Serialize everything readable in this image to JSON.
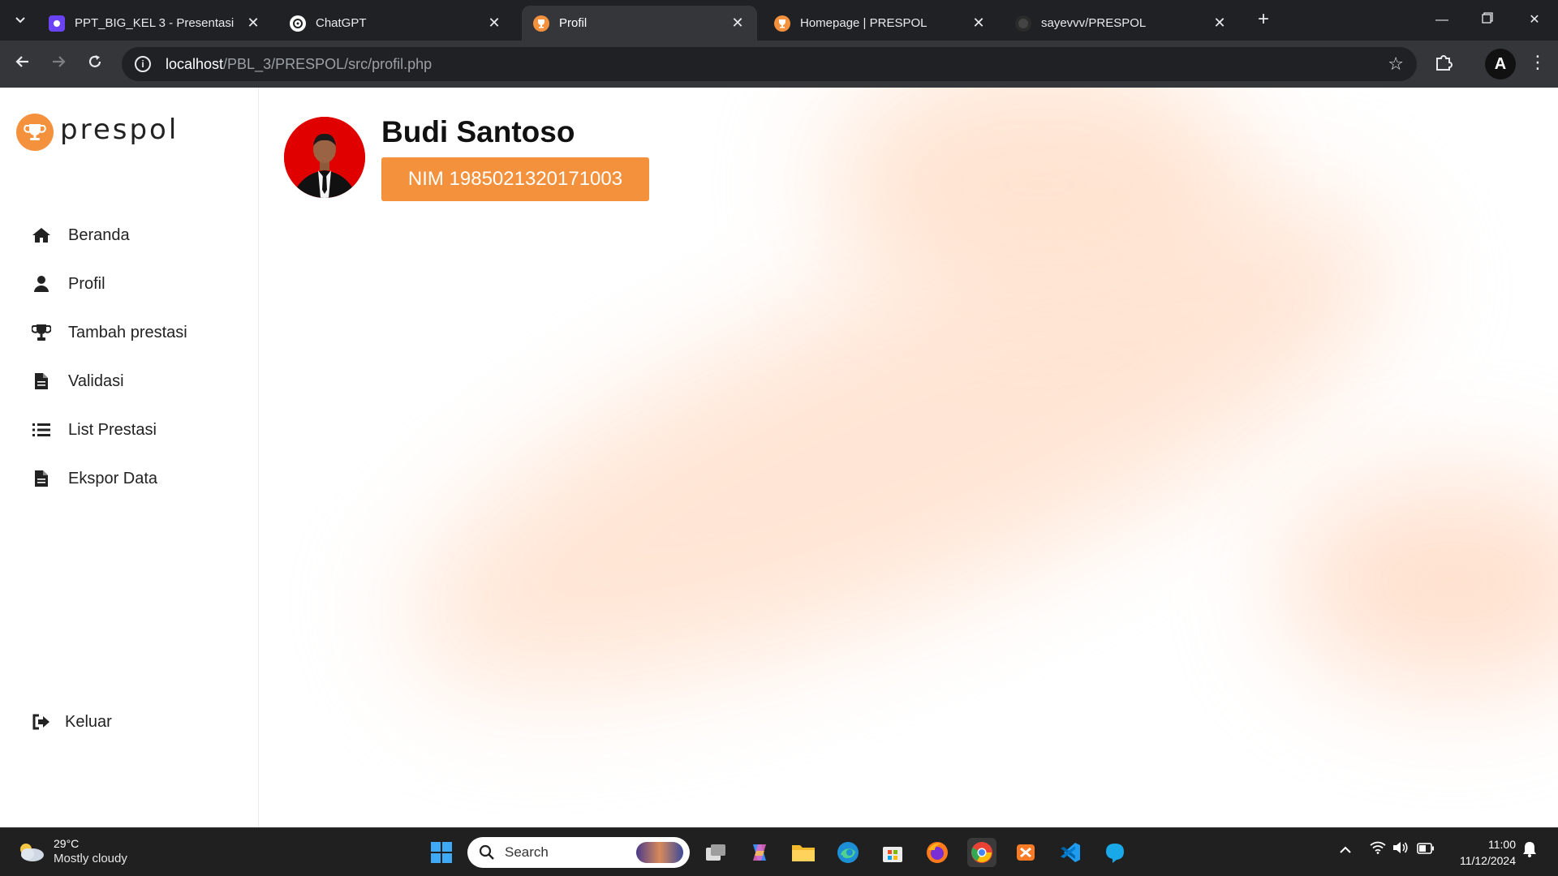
{
  "browser": {
    "tabs": [
      {
        "title": "PPT_BIG_KEL 3 - Presentasi",
        "active": false
      },
      {
        "title": "ChatGPT",
        "active": false
      },
      {
        "title": "Profil",
        "active": true
      },
      {
        "title": "Homepage | PRESPOL",
        "active": false
      },
      {
        "title": "sayevvv/PRESPOL",
        "active": false
      }
    ],
    "url_host": "localhost",
    "url_path": "/PBL_3/PRESPOL/src/profil.php"
  },
  "app": {
    "logo_text": "prespol",
    "brand_color": "#f4913d"
  },
  "sidebar": {
    "items": [
      {
        "label": "Beranda",
        "icon": "home-icon"
      },
      {
        "label": "Profil",
        "icon": "user-icon"
      },
      {
        "label": "Tambah prestasi",
        "icon": "trophy-icon"
      },
      {
        "label": "Validasi",
        "icon": "file-icon"
      },
      {
        "label": "List Prestasi",
        "icon": "list-icon"
      },
      {
        "label": "Ekspor Data",
        "icon": "file-icon"
      }
    ],
    "logout_label": "Keluar"
  },
  "profile": {
    "name": "Budi Santoso",
    "nim": "NIM 1985021320171003"
  },
  "taskbar": {
    "weather_temp": "29°C",
    "weather_condition": "Mostly cloudy",
    "search_label": "Search",
    "time": "11:00",
    "date": "11/12/2024"
  }
}
